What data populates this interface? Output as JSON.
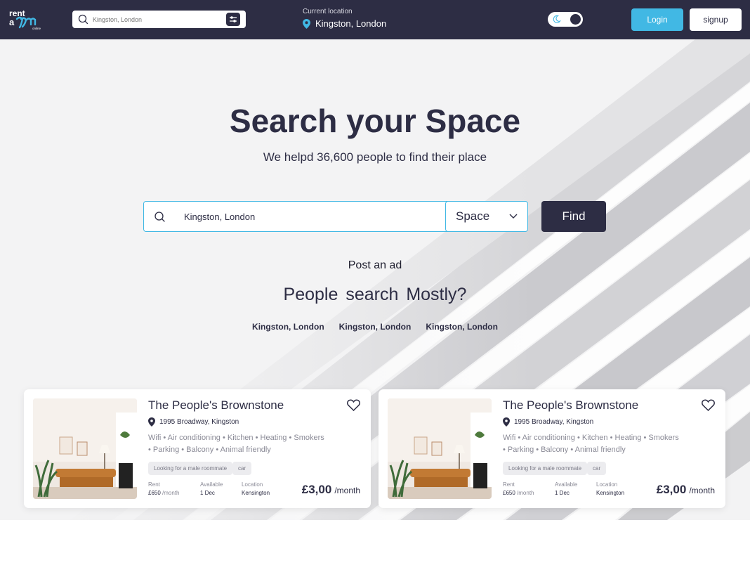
{
  "header": {
    "logo": "rent a room online",
    "search_placeholder": "Kingston, London",
    "current_location_label": "Current location",
    "current_location": "Kingston, London",
    "login_label": "Login",
    "signup_label": "signup",
    "dark_mode_enabled": true
  },
  "hero": {
    "title": "Search your Space",
    "subtitle": "We helpd 36,600 people to find their place",
    "search_value": "Kingston, London",
    "space_select": "Space",
    "find_label": "Find",
    "post_ad": "Post an ad",
    "people_search": "People  search  Mostly?",
    "popular": [
      "Kingston, London",
      "Kingston, London",
      "Kingston, London"
    ]
  },
  "listings": [
    {
      "title": "The People's Brownstone",
      "address": "1995 Broadway, Kingston",
      "features_line1": "Wifi • Air conditioning • Kitchen • Heating • Smokers",
      "features_line2": "• Parking • Balcony • Animal friendly",
      "tag1": "Looking for a male roommate",
      "tag2": "car",
      "rent_label": "Rent",
      "rent_value": "£650",
      "rent_unit": "/month",
      "available_label": "Available",
      "available_value": "1 Dec",
      "location_label": "Location",
      "location_value": "Kensington",
      "price": "£3,00",
      "price_unit": "/month"
    },
    {
      "title": "The People's Brownstone",
      "address": "1995 Broadway, Kingston",
      "features_line1": "Wifi • Air conditioning • Kitchen • Heating • Smokers",
      "features_line2": "• Parking • Balcony • Animal friendly",
      "tag1": "Looking for a male roommate",
      "tag2": "car",
      "rent_label": "Rent",
      "rent_value": "£650",
      "rent_unit": "/month",
      "available_label": "Available",
      "available_value": "1 Dec",
      "location_label": "Location",
      "location_value": "Kensington",
      "price": "£3,00",
      "price_unit": "/month"
    }
  ],
  "colors": {
    "navy": "#2d2d44",
    "accent": "#41b8e4",
    "page_bg": "#f3f3f4"
  }
}
